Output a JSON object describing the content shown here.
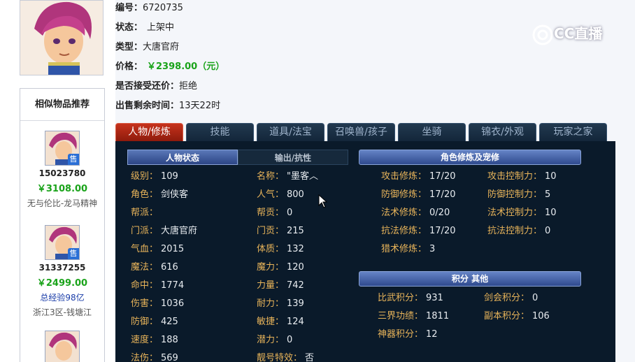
{
  "item": {
    "id_label": "编号：",
    "id_value": "6720735",
    "status_label": "状态：",
    "status_value": "上架中",
    "type_label": "类型：",
    "type_value": "大唐官府",
    "price_label": "价格：",
    "price_value": "￥2398.00（元）",
    "bargain_label": "是否接受还价：",
    "bargain_value": "拒绝",
    "remaining_label": "出售剩余时间：",
    "remaining_value": "13天22时"
  },
  "watermark": "CC直播",
  "recommend": {
    "title": "相似物品推荐",
    "sell_tag": "售",
    "items": [
      {
        "id": "15023780",
        "price": "￥3108.00",
        "desc": "无与伦比-龙马精神"
      },
      {
        "id": "31337255",
        "price": "￥2499.00",
        "desc": "总经验98亿",
        "desc2": "浙江3区-钱塘江"
      }
    ]
  },
  "tabs": [
    "人物/修炼",
    "技能",
    "道具/法宝",
    "召唤兽/孩子",
    "坐骑",
    "锦衣/外观",
    "玩家之家"
  ],
  "subtabs": {
    "status": "人物状态",
    "output": "输出/抗性"
  },
  "col1": [
    {
      "k": "级别：",
      "v": "109"
    },
    {
      "k": "角色：",
      "v": "剑侠客"
    },
    {
      "k": "帮派：",
      "v": ""
    },
    {
      "k": "门派：",
      "v": "大唐官府"
    },
    {
      "k": "气血：",
      "v": "2015"
    },
    {
      "k": "魔法：",
      "v": "616"
    },
    {
      "k": "命中：",
      "v": "1774"
    },
    {
      "k": "伤害：",
      "v": "1036"
    },
    {
      "k": "防御：",
      "v": "425"
    },
    {
      "k": "速度：",
      "v": "188"
    },
    {
      "k": "法伤：",
      "v": "569"
    }
  ],
  "col2": [
    {
      "k": "名称：",
      "v": "\"墨客︿"
    },
    {
      "k": "人气：",
      "v": "800"
    },
    {
      "k": "帮贡：",
      "v": "0"
    },
    {
      "k": "门贡：",
      "v": "215"
    },
    {
      "k": "体质：",
      "v": "132"
    },
    {
      "k": "魔力：",
      "v": "120"
    },
    {
      "k": "力量：",
      "v": "742"
    },
    {
      "k": "耐力：",
      "v": "139"
    },
    {
      "k": "敏捷：",
      "v": "124"
    },
    {
      "k": "潜力：",
      "v": "0"
    },
    {
      "k": "靓号特效：",
      "v": "否"
    }
  ],
  "cultivation": {
    "title": "角色修炼及宠修",
    "left": [
      {
        "k": "攻击修炼：",
        "v": "17/20"
      },
      {
        "k": "防御修炼：",
        "v": "17/20"
      },
      {
        "k": "法术修炼：",
        "v": "0/20"
      },
      {
        "k": "抗法修炼：",
        "v": "17/20"
      },
      {
        "k": "猎术修炼：",
        "v": "3"
      }
    ],
    "right": [
      {
        "k": "攻击控制力：",
        "v": "10"
      },
      {
        "k": "防御控制力：",
        "v": "5"
      },
      {
        "k": "法术控制力：",
        "v": "10"
      },
      {
        "k": "抗法控制力：",
        "v": "0"
      }
    ]
  },
  "points": {
    "title": "积分 其他",
    "left": [
      {
        "k": "比武积分：",
        "v": "931"
      },
      {
        "k": "三界功绩：",
        "v": "1811"
      },
      {
        "k": "神器积分：",
        "v": "12"
      }
    ],
    "right": [
      {
        "k": "剑会积分：",
        "v": "0"
      },
      {
        "k": "副本积分：",
        "v": "106"
      }
    ]
  },
  "colors": {
    "accent_green": "#1aa31a",
    "panel_bg": "#0a1a2a",
    "key_gold": "#e8b45a"
  }
}
